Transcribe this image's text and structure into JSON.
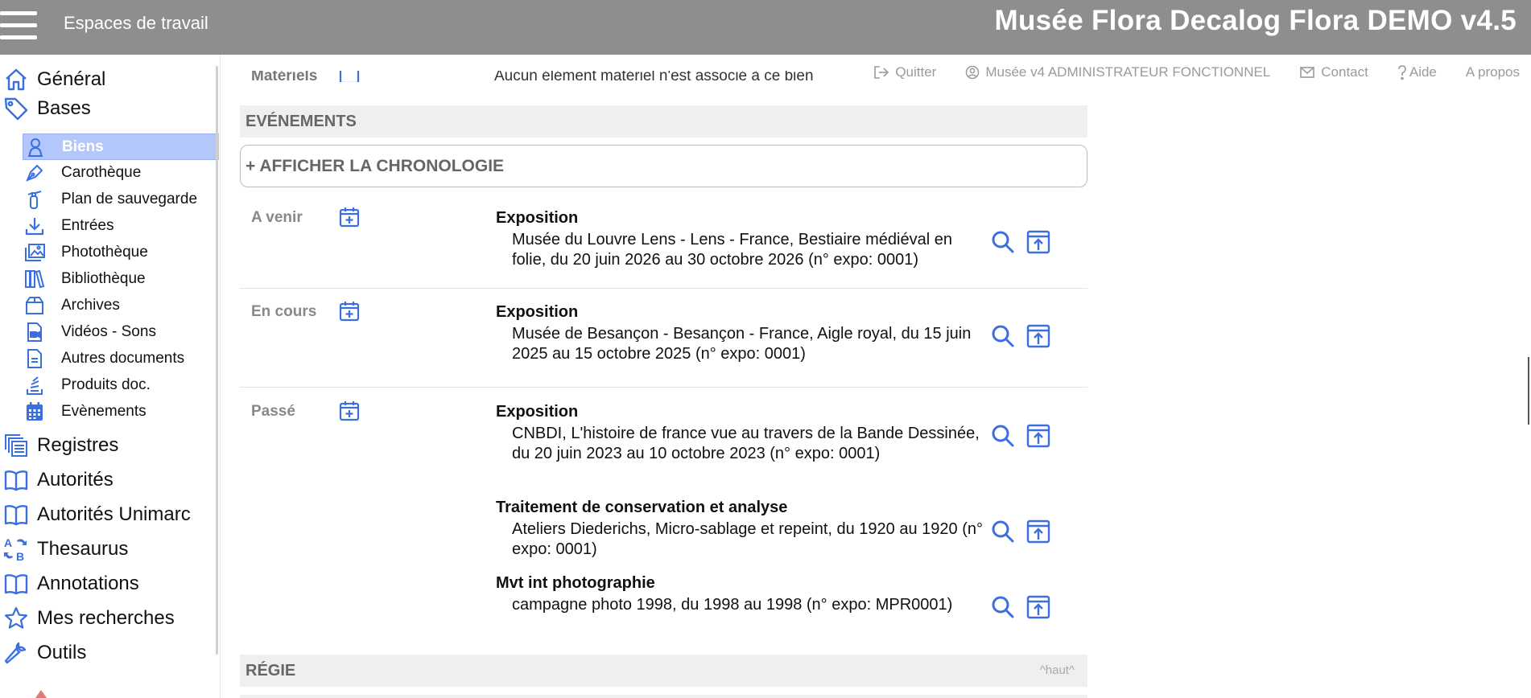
{
  "header": {
    "workspaces_label": "Espaces de travail",
    "app_title": "Musée Flora Decalog Flora DEMO v4.5"
  },
  "top_links": {
    "quit": "Quitter",
    "user": "Musée v4 ADMINISTRATEUR FONCTIONNEL",
    "contact": "Contact",
    "help": "Aide",
    "about": "A propos"
  },
  "sidebar": {
    "main_items": [
      {
        "label": "Général",
        "icon": "home-icon"
      },
      {
        "label": "Bases",
        "icon": "tag-icon"
      },
      {
        "label": "Registres",
        "icon": "registers-icon"
      },
      {
        "label": "Autorités",
        "icon": "book-icon"
      },
      {
        "label": "Autorités Unimarc",
        "icon": "book-icon"
      },
      {
        "label": "Thesaurus",
        "icon": "sort-az-icon"
      },
      {
        "label": "Annotations",
        "icon": "book-icon"
      },
      {
        "label": "Mes recherches",
        "icon": "star-icon"
      },
      {
        "label": "Outils",
        "icon": "wrench-icon"
      }
    ],
    "sub_items": [
      {
        "label": "Biens",
        "icon": "bust-icon",
        "active": true
      },
      {
        "label": "Carothèque",
        "icon": "pen-icon"
      },
      {
        "label": "Plan de sauvegarde",
        "icon": "extinguisher-icon"
      },
      {
        "label": "Entrées",
        "icon": "download-icon"
      },
      {
        "label": "Photothèque",
        "icon": "images-icon"
      },
      {
        "label": "Bibliothèque",
        "icon": "books-icon"
      },
      {
        "label": "Archives",
        "icon": "box-icon"
      },
      {
        "label": "Vidéos - Sons",
        "icon": "video-file-icon"
      },
      {
        "label": "Autres documents",
        "icon": "document-icon"
      },
      {
        "label": "Produits doc.",
        "icon": "stack-icon"
      },
      {
        "label": "Evènements",
        "icon": "calendar-icon"
      }
    ]
  },
  "main": {
    "partial_row": {
      "label": "Matériels",
      "text": "Aucun élément matériel n'est associé à ce bien"
    },
    "events_section": "EVÉNEMENTS",
    "chronology_button": "+ AFFICHER LA CHRONOLOGIE",
    "groups": [
      {
        "label": "A venir",
        "events": [
          {
            "title": "Exposition",
            "desc": "Musée du Louvre Lens - Lens - France, Bestiaire médiéval en folie, du 20 juin 2026 au 30 octobre 2026 (n° expo: 0001)"
          }
        ]
      },
      {
        "label": "En cours",
        "events": [
          {
            "title": "Exposition",
            "desc": "Musée de Besançon - Besançon - France, Aigle royal, du 15 juin 2025 au 15 octobre 2025 (n° expo: 0001)"
          }
        ]
      },
      {
        "label": "Passé",
        "events": [
          {
            "title": "Exposition",
            "desc": "CNBDI, L'histoire de france vue au travers de la Bande Dessinée, du 20 juin 2023 au 10 octobre 2023 (n° expo: 0001)"
          },
          {
            "title": "Traitement de conservation et analyse",
            "desc": "Ateliers Diederichs, Micro-sablage et repeint, du 1920 au 1920 (n° expo: 0001)"
          },
          {
            "title": "Mvt int photographie",
            "desc": "campagne photo 1998, du 1998 au 1998 (n° expo: MPR0001)"
          }
        ]
      }
    ],
    "regie_section": "RÉGIE",
    "haut_link": "^haut^"
  },
  "colors": {
    "header_bg": "#8e8e8e",
    "accent": "#3b6fe0",
    "active_item_bg": "#b3c7fb"
  }
}
